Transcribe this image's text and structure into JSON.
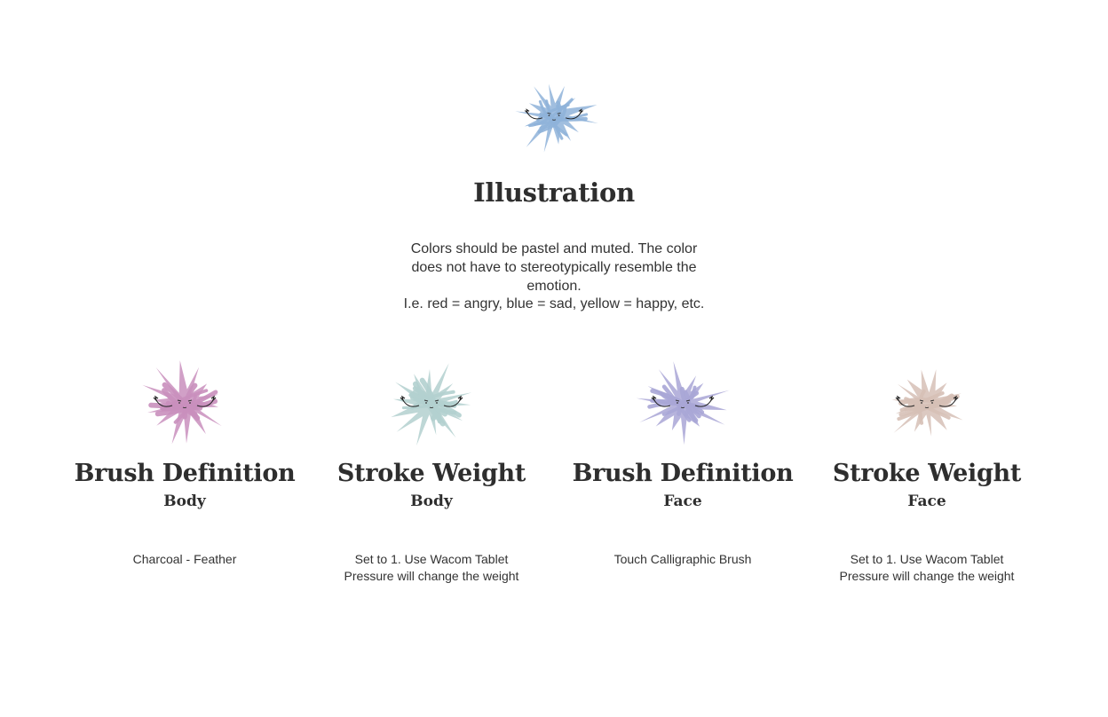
{
  "hero": {
    "title": "Illustration",
    "description_lines": [
      "Colors should be pastel and muted. The color",
      "does not have to stereotypically resemble the",
      "emotion.",
      "I.e.  red = angry, blue = sad, yellow = happy, etc."
    ],
    "color": "#8fb3d9"
  },
  "columns": [
    {
      "title": "Brush Definition",
      "subtitle": "Body",
      "description_lines": [
        "Charcoal - Feather"
      ],
      "color": "#c98fbd"
    },
    {
      "title": "Stroke Weight",
      "subtitle": "Body",
      "description_lines": [
        "Set to 1. Use Wacom Tablet",
        "Pressure will change the weight"
      ],
      "color": "#b3d0cf"
    },
    {
      "title": "Brush Definition",
      "subtitle": "Face",
      "description_lines": [
        "Touch Calligraphic Brush"
      ],
      "color": "#a9a6d6"
    },
    {
      "title": "Stroke Weight",
      "subtitle": "Face",
      "description_lines": [
        "Set to 1. Use Wacom Tablet",
        "Pressure will change the weight"
      ],
      "color": "#d6c0b6"
    }
  ]
}
